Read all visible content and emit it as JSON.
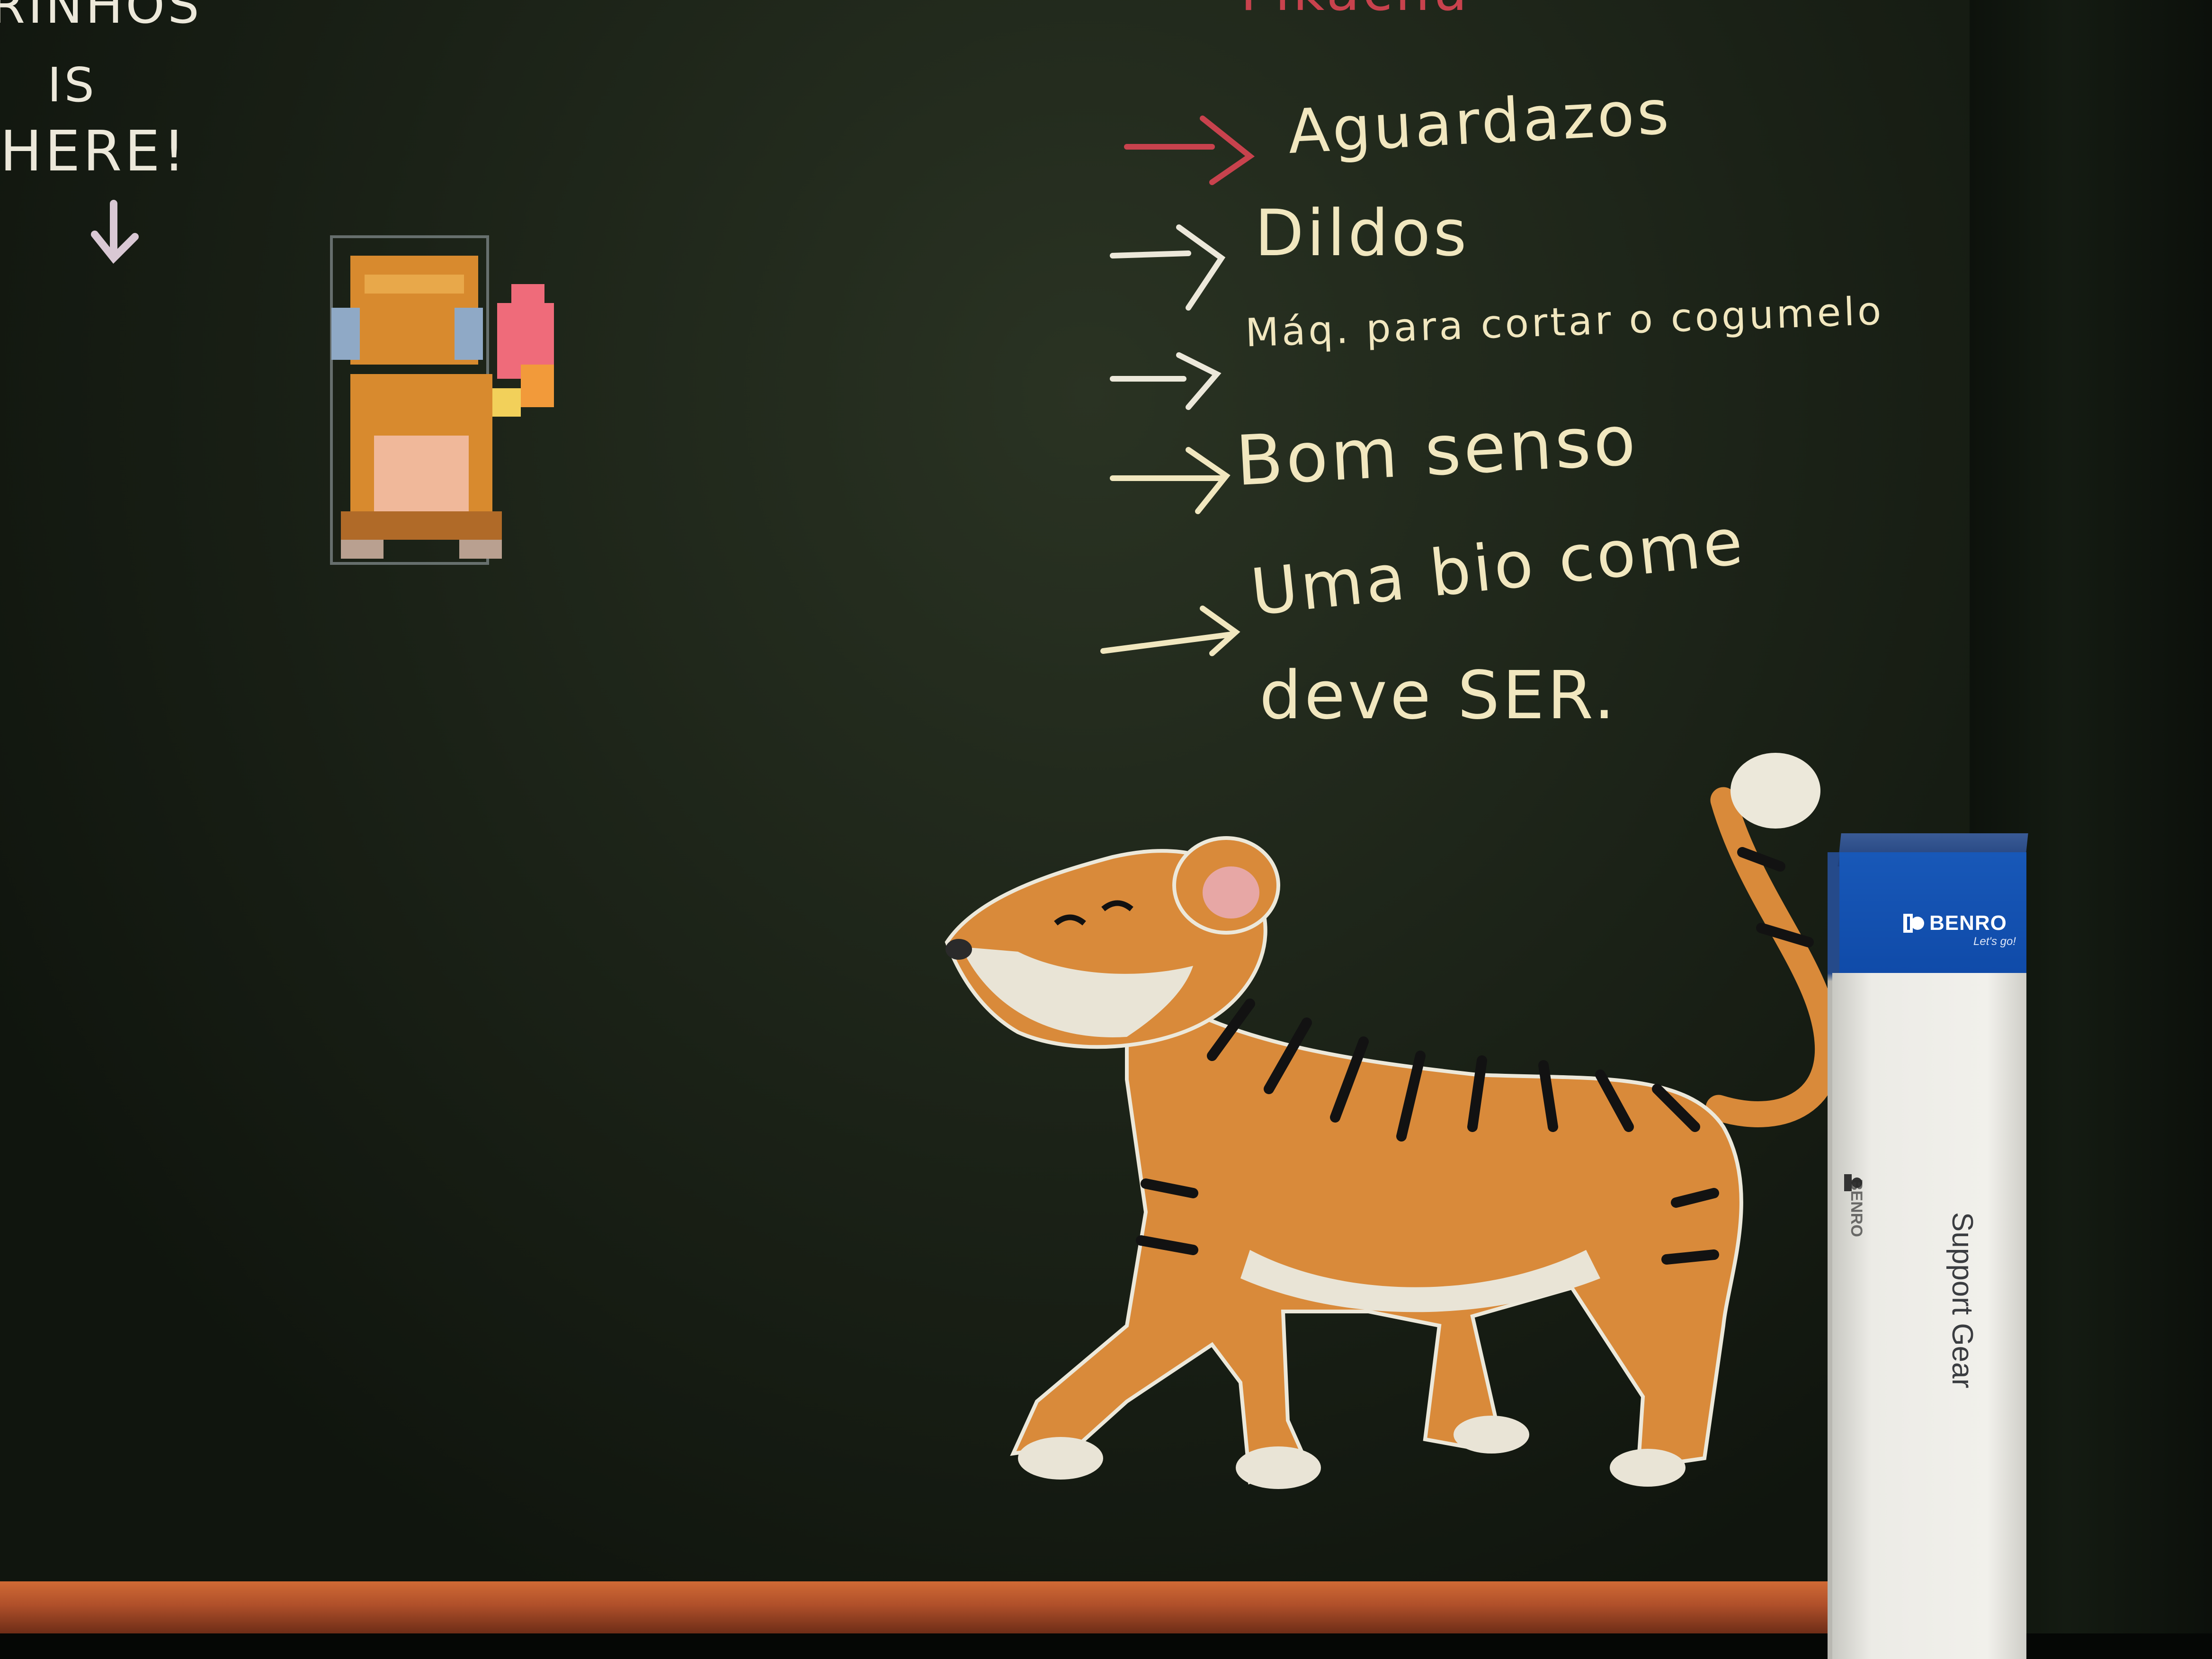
{
  "scene": {
    "description_colors": {
      "board": "#1b2217",
      "chalk_yellow": "#f1e7bf",
      "chalk_red": "#c8424d",
      "tiger_orange": "#d98a3a",
      "ledge": "#c05c2f",
      "box_blue": "#1556b4"
    }
  },
  "chalk_text": {
    "top_left": [
      "RINHOS",
      "IS",
      "HERE!"
    ],
    "top_heading": "Pikachu",
    "list": [
      "Aguardazos",
      "Dildos",
      "Máq. para cortar o cogumelo",
      "Bom senso",
      "Uma bio come",
      "deve SER."
    ]
  },
  "box": {
    "brand": "BENRO",
    "tagline": "Let's go!",
    "product": "Support Gear"
  }
}
